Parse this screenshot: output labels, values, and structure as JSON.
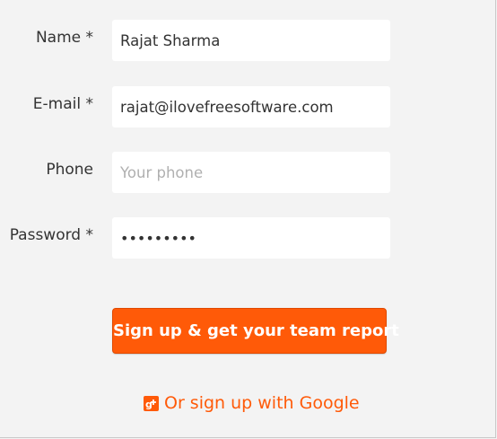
{
  "form": {
    "name": {
      "label": "Name *",
      "value": "Rajat Sharma",
      "placeholder": ""
    },
    "email": {
      "label": "E-mail *",
      "value": "rajat@ilovefreesoftware.com",
      "placeholder": ""
    },
    "phone": {
      "label": "Phone",
      "value": "",
      "placeholder": "Your phone"
    },
    "password": {
      "label": "Password *",
      "value": "•••••••••",
      "placeholder": ""
    }
  },
  "signup_button": {
    "label": "Sign up & get your team report"
  },
  "google_link": {
    "label": "Or sign up with Google",
    "icon": "google-plus-icon"
  },
  "colors": {
    "accent": "#ff5a08",
    "background": "#f3f3f3",
    "field_background": "#ffffff",
    "placeholder": "#b0b0b0",
    "label_text": "#333333"
  }
}
